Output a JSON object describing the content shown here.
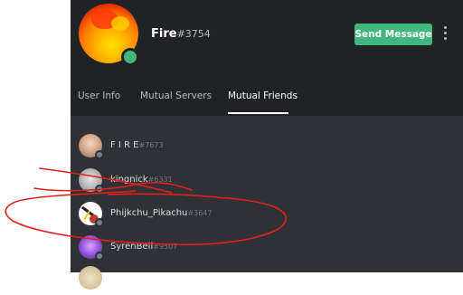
{
  "profile": {
    "username": "Fire",
    "discriminator": "#3754",
    "status": "online",
    "avatar_icon": "fire-avatar"
  },
  "actions": {
    "send_message_label": "Send Message",
    "more_icon": "vertical-ellipsis-icon"
  },
  "tabs": [
    {
      "label": "User Info",
      "active": false
    },
    {
      "label": "Mutual Servers",
      "active": false
    },
    {
      "label": "Mutual Friends",
      "active": true
    }
  ],
  "mutual_friends": [
    {
      "name": "F I R E",
      "discriminator": "#7673",
      "status": "offline"
    },
    {
      "name": "kingnick",
      "discriminator": "#6331",
      "status": "offline"
    },
    {
      "name": "Phijkchu_Pikachu",
      "discriminator": "#3647",
      "status": "offline"
    },
    {
      "name": "SyrenBell",
      "discriminator": "#9507",
      "status": "offline"
    },
    {
      "name": "",
      "discriminator": "",
      "status": "offline"
    }
  ],
  "colors": {
    "panel_bg": "#202225",
    "list_bg": "#2f3136",
    "accent_green": "#43b581",
    "annotation_red": "#e0201b"
  }
}
